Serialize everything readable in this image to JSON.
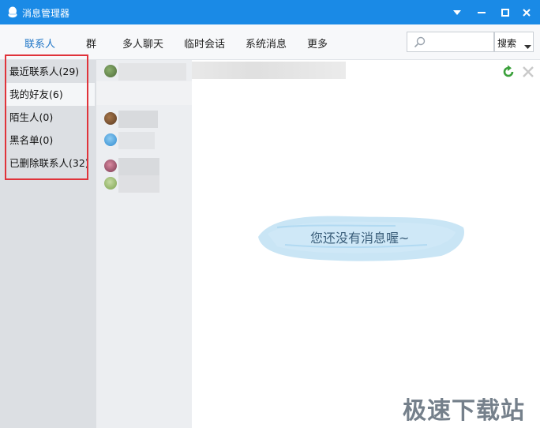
{
  "window": {
    "title": "消息管理器",
    "accent": "#1a8ae6"
  },
  "tabs": [
    {
      "label": "联系人",
      "active": true
    },
    {
      "label": "群"
    },
    {
      "label": "多人聊天"
    },
    {
      "label": "临时会话"
    },
    {
      "label": "系统消息"
    },
    {
      "label": "更多"
    }
  ],
  "search": {
    "placeholder": "",
    "scope_label": "搜索",
    "icon": "search-icon"
  },
  "categories": [
    {
      "label": "最近联系人(29)"
    },
    {
      "label": "我的好友(6)"
    },
    {
      "label": "陌生人(0)"
    },
    {
      "label": "黑名单(0)"
    },
    {
      "label": "已删除联系人(32)"
    }
  ],
  "content": {
    "empty_message": "您还没有消息喔~",
    "actions": [
      "refresh-icon",
      "delete-icon"
    ]
  },
  "watermark": "极速下载站"
}
